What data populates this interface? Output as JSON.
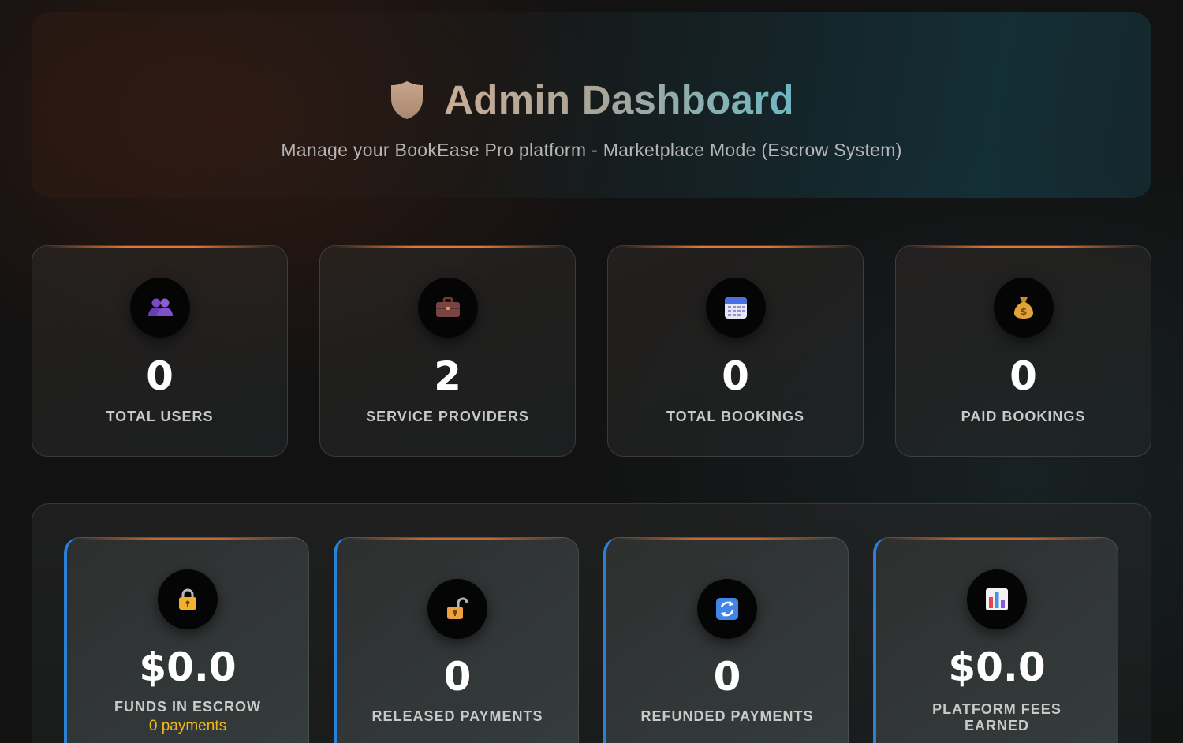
{
  "header": {
    "title": "Admin Dashboard",
    "subtitle": "Manage your BookEase Pro platform - Marketplace Mode (Escrow System)",
    "icon": "shield-icon"
  },
  "stats": [
    {
      "icon": "users-icon",
      "value": "0",
      "label": "TOTAL USERS"
    },
    {
      "icon": "briefcase-icon",
      "value": "2",
      "label": "SERVICE PROVIDERS"
    },
    {
      "icon": "calendar-icon",
      "value": "0",
      "label": "TOTAL BOOKINGS"
    },
    {
      "icon": "money-bag-icon",
      "value": "0",
      "label": "PAID BOOKINGS"
    }
  ],
  "escrow": [
    {
      "icon": "lock-icon",
      "value": "$0.0",
      "label": "FUNDS IN ESCROW",
      "note": "0 payments"
    },
    {
      "icon": "unlock-icon",
      "value": "0",
      "label": "RELEASED PAYMENTS"
    },
    {
      "icon": "refresh-icon",
      "value": "0",
      "label": "REFUNDED PAYMENTS"
    },
    {
      "icon": "bar-chart-icon",
      "value": "$0.0",
      "label_line1": "PLATFORM FEES",
      "label_line2": "EARNED"
    }
  ],
  "colors": {
    "accent_orange": "#e0763a",
    "accent_blue": "#2a7fd6",
    "note_yellow": "#f2b81c"
  }
}
